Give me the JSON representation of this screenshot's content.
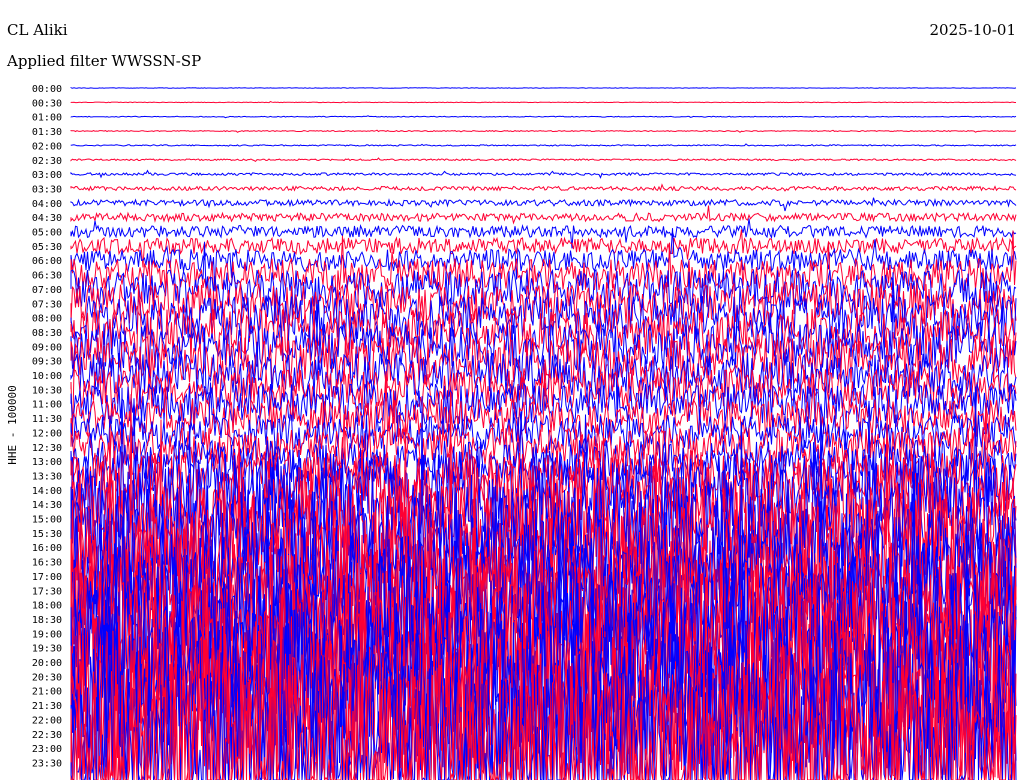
{
  "header": {
    "station": "CL Aliki",
    "date": "2025-10-01",
    "filter": "Applied filter WWSSN-SP"
  },
  "chart_data": {
    "type": "line",
    "title": "CL Aliki",
    "subtitle": "Applied filter WWSSN-SP",
    "date": "2025-10-01",
    "ylabel": "HHE - 100000",
    "row_labels": [
      "00:00",
      "00:30",
      "01:00",
      "01:30",
      "02:00",
      "02:30",
      "03:00",
      "03:30",
      "04:00",
      "04:30",
      "05:00",
      "05:30",
      "06:00",
      "06:30",
      "07:00",
      "07:30",
      "08:00",
      "08:30",
      "09:00",
      "09:30",
      "10:00",
      "10:30",
      "11:00",
      "11:30",
      "12:00",
      "12:30",
      "13:00",
      "13:30",
      "14:00",
      "14:30",
      "15:00",
      "15:30",
      "16:00",
      "16:30",
      "17:00",
      "17:30",
      "18:00",
      "18:30",
      "19:00",
      "19:30",
      "20:00",
      "20:30",
      "21:00",
      "21:30",
      "22:00",
      "22:30",
      "23:00",
      "23:30"
    ],
    "row_colors": [
      "#0000ff",
      "#ff0033"
    ],
    "grid": false,
    "legend": "none",
    "traces_per_row_amplitude_estimate": [
      0.2,
      0.3,
      0.4,
      0.5,
      0.6,
      0.8,
      1.2,
      2,
      3,
      4,
      6,
      8,
      11,
      16,
      19,
      21,
      22,
      23,
      24,
      24,
      22,
      20,
      20,
      19,
      18,
      19,
      21,
      26,
      38,
      48,
      52,
      55,
      60,
      62,
      64,
      66,
      70,
      75,
      80,
      85,
      88,
      90,
      92,
      95,
      98,
      100,
      100,
      100
    ]
  }
}
